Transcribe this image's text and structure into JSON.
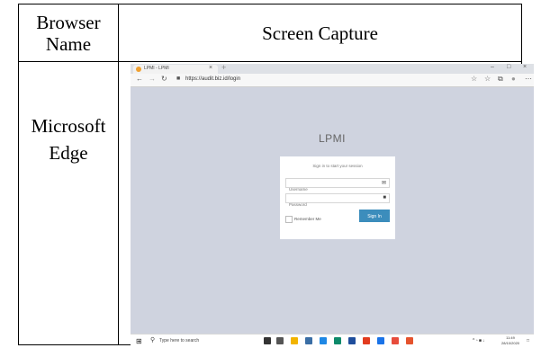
{
  "table": {
    "header_col1": "Browser Name",
    "header_col2": "Screen Capture",
    "row1_browser": "Microsoft Edge"
  },
  "screenshot": {
    "tab": {
      "title": "LPMI - LPMI",
      "close": "×",
      "new_tab": "+"
    },
    "window": {
      "minimize": "–",
      "maximize": "□",
      "close": "×"
    },
    "nav": {
      "back": "←",
      "forward": "→",
      "reload": "↻",
      "lock": "🔒"
    },
    "url": "https://audit.biz.id/login",
    "toolbar_icons": [
      "star-icon",
      "favorites-icon",
      "collections-icon",
      "profile-icon",
      "more-icon"
    ],
    "toolbar_glyphs": [
      "☆",
      "☆",
      "⧉",
      "●",
      "⋯"
    ],
    "login": {
      "title": "LPMI",
      "message": "Sign in to start your session",
      "username_placeholder": "Username",
      "password_placeholder": "Password",
      "remember_label": "Remember Me",
      "signin_label": "Sign In"
    },
    "taskbar": {
      "search_placeholder": "Type here to search",
      "clock_time": "11:49",
      "clock_date": "28/10/2020",
      "app_colors": [
        "#333333",
        "#555555",
        "#f2b400",
        "#3a6ea5",
        "#1e88e5",
        "#0d8a6a",
        "#1f4e9c",
        "#e23b1e",
        "#1a73e8",
        "#e74c3c",
        "#e5532d"
      ]
    }
  }
}
